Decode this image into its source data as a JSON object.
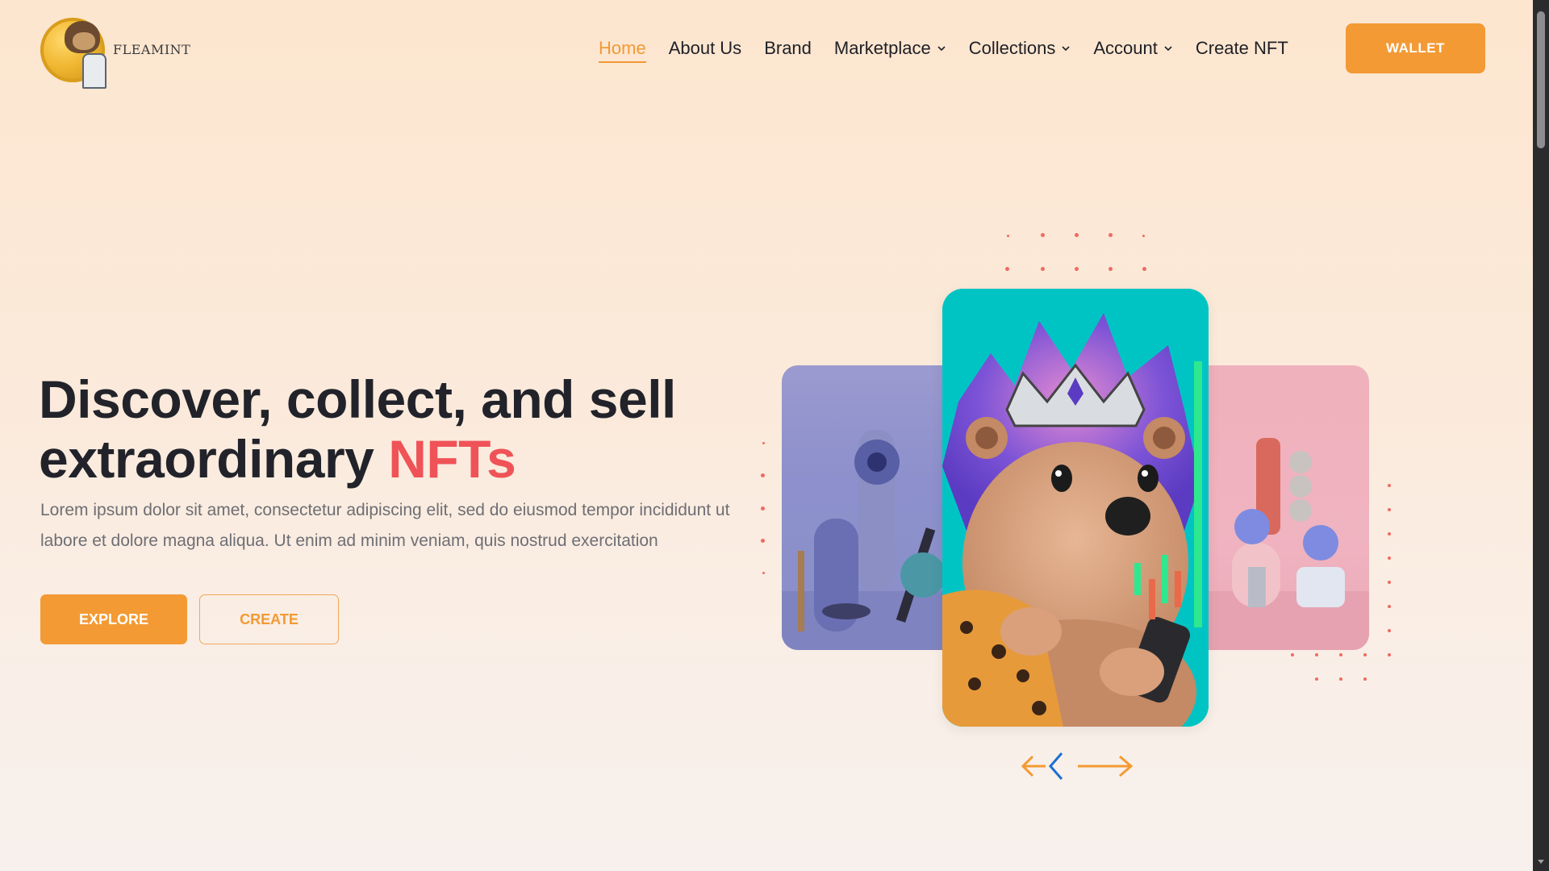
{
  "brand": {
    "name": "FLEAMINT",
    "logo_icon": "ape-coin-logo"
  },
  "nav": {
    "items": [
      {
        "label": "Home",
        "active": true,
        "dropdown": false
      },
      {
        "label": "About Us",
        "active": false,
        "dropdown": false
      },
      {
        "label": "Brand",
        "active": false,
        "dropdown": false
      },
      {
        "label": "Marketplace",
        "active": false,
        "dropdown": true
      },
      {
        "label": "Collections",
        "active": false,
        "dropdown": true
      },
      {
        "label": "Account",
        "active": false,
        "dropdown": true
      },
      {
        "label": "Create NFT",
        "active": false,
        "dropdown": false
      }
    ],
    "wallet_label": "WALLET"
  },
  "hero": {
    "title_main": "Discover, collect, and sell extraordinary ",
    "title_accent": "NFTs",
    "description": "Lorem ipsum dolor sit amet, consectetur adipiscing elit, sed do eiusmod tempor incididunt ut labore et dolore magna aliqua. Ut enim ad minim veniam, quis nostrud exercitation",
    "explore_label": "EXPLORE",
    "create_label": "CREATE"
  },
  "slider": {
    "cards": [
      "abstract-vacuum-sculpture",
      "hedgehog-king-nft",
      "abstract-pink-sculpture"
    ],
    "prev_icon": "arrow-left-icon",
    "next_icon": "arrow-right-icon"
  },
  "colors": {
    "accent": "#f39a34",
    "highlight": "#ef5357",
    "text_dark": "#22232a",
    "text_muted": "#6e6e74",
    "card_center_bg": "#00c4c4"
  }
}
